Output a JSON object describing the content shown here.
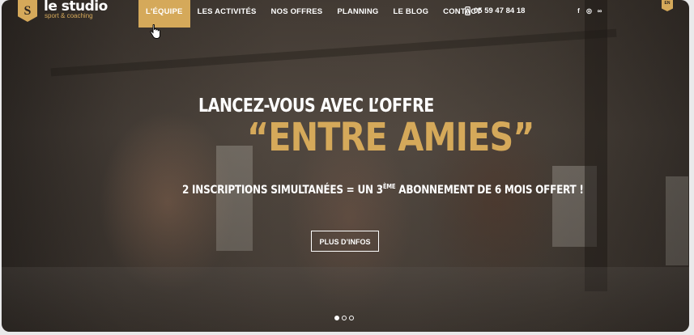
{
  "logo": {
    "badge": "S",
    "title": "le studio",
    "subtitle": "sport & coaching"
  },
  "nav": {
    "items": [
      {
        "label": "L'ÉQUIPE",
        "active": true
      },
      {
        "label": "LES ACTIVITÉS",
        "active": false
      },
      {
        "label": "NOS OFFRES",
        "active": false
      },
      {
        "label": "PLANNING",
        "active": false
      },
      {
        "label": "LE BLOG",
        "active": false
      },
      {
        "label": "CONTACT",
        "active": false
      }
    ]
  },
  "header": {
    "phone": "05 59 47 84 18",
    "phone_icon": "phone-icon",
    "social": [
      {
        "icon": "facebook-icon",
        "glyph": "f"
      },
      {
        "icon": "instagram-icon",
        "glyph": "◎"
      },
      {
        "icon": "tripadvisor-icon",
        "glyph": "∞"
      }
    ],
    "lang": "EN"
  },
  "hero": {
    "line1": "LANCEZ-VOUS AVEC L’OFFRE",
    "line2": "“ENTRE AMIES”",
    "sub_before": "2 INSCRIPTIONS SIMULTANÉES = UN 3",
    "sub_sup": "ÈME",
    "sub_after": " ABONNEMENT DE 6 MOIS OFFERT !",
    "button": "PLUS D’INFOS"
  },
  "slider": {
    "count": 3,
    "active_index": 0
  },
  "colors": {
    "accent": "#d5a95a",
    "text": "#ffffff"
  }
}
